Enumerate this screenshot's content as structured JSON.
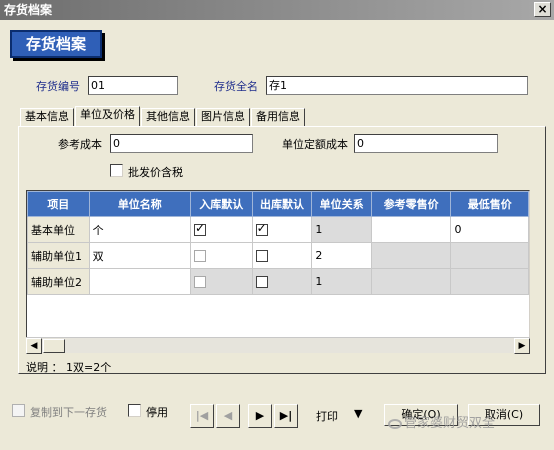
{
  "window": {
    "title": "存货档案",
    "close": "×"
  },
  "header": {
    "big_title": "存货档案"
  },
  "form": {
    "code_label": "存货编号",
    "code_value": "01",
    "fullname_label": "存货全名",
    "fullname_value": "存1"
  },
  "tabs": [
    "基本信息",
    "单位及价格",
    "其他信息",
    "图片信息",
    "备用信息"
  ],
  "active_tab": 1,
  "price": {
    "ref_cost_label": "参考成本",
    "ref_cost_value": "0",
    "unit_fixed_cost_label": "单位定额成本",
    "unit_fixed_cost_value": "0",
    "wholesale_tax_label": "批发价含税",
    "wholesale_tax_checked": false
  },
  "grid": {
    "columns": [
      "项目",
      "单位名称",
      "入库默认",
      "出库默认",
      "单位关系",
      "参考零售价",
      "最低售价"
    ],
    "rows": [
      {
        "item": "基本单位",
        "unit_name": "个",
        "in_default": true,
        "out_default": true,
        "relation": "1",
        "retail": "",
        "min_price": "0"
      },
      {
        "item": "辅助单位1",
        "unit_name": "双",
        "in_default": false,
        "out_default": false,
        "relation": "2",
        "retail": "",
        "min_price": ""
      },
      {
        "item": "辅助单位2",
        "unit_name": "",
        "in_default": false,
        "out_default": false,
        "relation": "1",
        "retail": "",
        "min_price": ""
      }
    ]
  },
  "note": "说明 ： 1双=2个",
  "footer": {
    "copy_next_label": "复制到下一存货",
    "disable_label": "停用",
    "print_label": "打印",
    "print_arrow": "▼",
    "ok_label": "确定(O)",
    "cancel_label": "取消(C)",
    "nav": [
      "|◀",
      "◀",
      "▶",
      "▶|"
    ]
  },
  "watermark": "管家婆财贸双全"
}
